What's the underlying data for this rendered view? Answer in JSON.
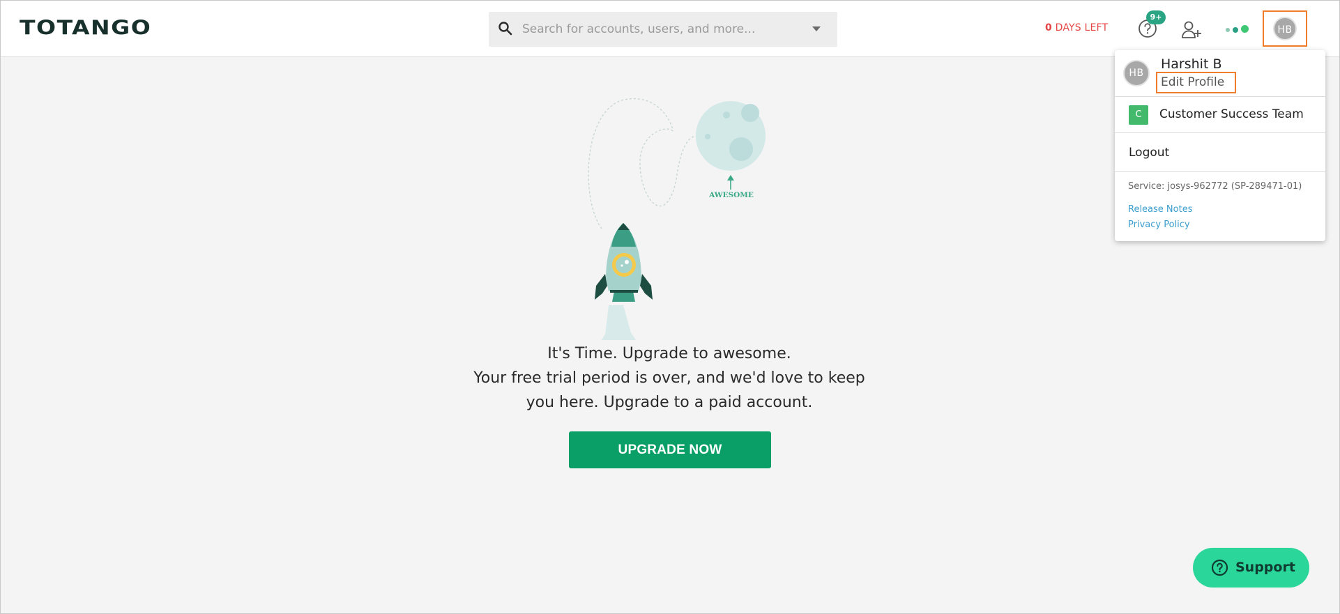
{
  "header": {
    "logo_text": "TOTANGO",
    "search": {
      "placeholder": "Search for accounts, users, and more..."
    },
    "trial": {
      "days": "0",
      "suffix": " DAYS LEFT"
    },
    "help_badge": "9+",
    "user_initials": "HB",
    "icons": [
      "search-icon",
      "chevron-down-icon",
      "help-icon",
      "add-user-icon",
      "status-dots-icon",
      "avatar"
    ]
  },
  "user_menu": {
    "initials": "HB",
    "name": "Harshit B",
    "edit_profile": "Edit Profile",
    "team_initial": "C",
    "team_name": "Customer Success Team",
    "logout": "Logout",
    "service": "Service: josys-962772 (SP-289471-01)",
    "release_notes": "Release Notes",
    "privacy_policy": "Privacy Policy"
  },
  "main": {
    "illustration_label": "AWESOME",
    "line1": "It's Time. Upgrade to awesome.",
    "line2": "Your free trial period is over, and we'd love to keep",
    "line3": "you here. Upgrade to a paid account.",
    "cta": "UPGRADE NOW"
  },
  "support": {
    "label": "Support"
  },
  "colors": {
    "brand_dark": "#17302c",
    "accent_green": "#0a9f66",
    "support_green": "#2bd69b",
    "alert_red": "#e64545",
    "highlight_orange": "#ef7d2b",
    "link_blue": "#3b9ecc"
  }
}
